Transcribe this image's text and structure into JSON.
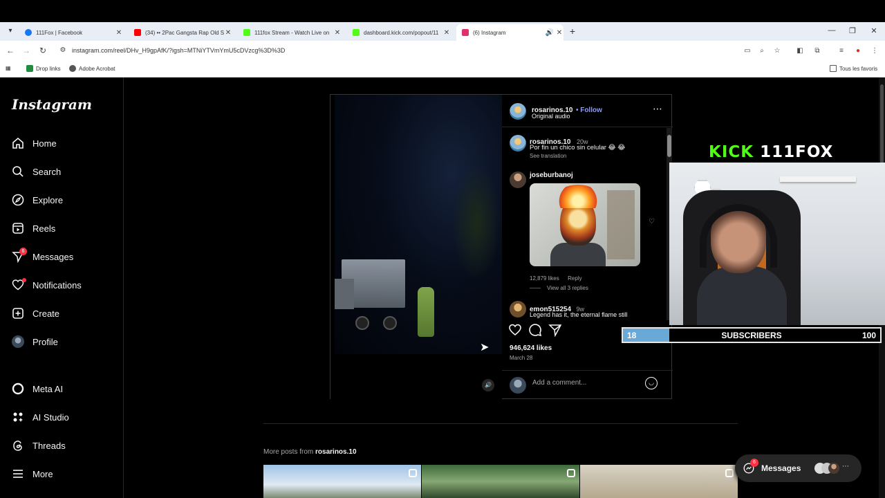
{
  "browser": {
    "tabs": [
      {
        "title": "111Fox | Facebook",
        "favicon_color": "#1877f2"
      },
      {
        "title": "(34) •• 2Pac Gangsta Rap Old S",
        "favicon_color": "#ff0000"
      },
      {
        "title": "111fox Stream - Watch Live on",
        "favicon_color": "#53fc18"
      },
      {
        "title": "dashboard.kick.com/popout/11",
        "favicon_color": "#53fc18"
      },
      {
        "title": "(6) Instagram",
        "favicon_color": "#e1306c"
      }
    ],
    "url": "instagram.com/reel/DHv_H9gpAfK/?igsh=MTNiYTVmYmU5cDVzcg%3D%3D",
    "bookmarks": [
      {
        "label": "Drop links",
        "color": "#1e8e3e"
      },
      {
        "label": "Adobe Acrobat",
        "color": "#555555"
      }
    ],
    "bookmarks_right": "Tous les favoris"
  },
  "instagram": {
    "logo": "Instagram",
    "nav": [
      {
        "label": "Home",
        "icon": "home-icon"
      },
      {
        "label": "Search",
        "icon": "search-icon"
      },
      {
        "label": "Explore",
        "icon": "compass-icon"
      },
      {
        "label": "Reels",
        "icon": "reels-icon"
      },
      {
        "label": "Messages",
        "icon": "messenger-icon",
        "badge": "6"
      },
      {
        "label": "Notifications",
        "icon": "heart-icon",
        "dot": true
      },
      {
        "label": "Create",
        "icon": "plus-square-icon"
      },
      {
        "label": "Profile",
        "icon": "avatar-icon"
      },
      {
        "label": "Meta AI",
        "icon": "meta-ai-icon"
      },
      {
        "label": "AI Studio",
        "icon": "ai-studio-icon"
      },
      {
        "label": "Threads",
        "icon": "threads-icon"
      },
      {
        "label": "More",
        "icon": "menu-icon"
      }
    ],
    "post": {
      "author": "rosarinos.10",
      "follow": "• Follow",
      "audio": "Original audio",
      "caption_user": "rosarinos.10",
      "caption_age": "20w",
      "caption": "Por fin un chico sin celular 😂 😂",
      "see_translation": "See translation",
      "comments": [
        {
          "user": "joseburbanoj",
          "likes": "12,879 likes",
          "reply": "Reply",
          "view_replies": "View all 3 replies"
        },
        {
          "user": "emon515254",
          "age": "9w",
          "text": "Legend has it, the eternal flame still"
        }
      ],
      "likes": "946,624 likes",
      "date": "March 28",
      "add_comment": "Add a comment..."
    },
    "more_posts_prefix": "More posts from",
    "more_posts_user": "rosarinos.10",
    "messages_pill": {
      "label": "Messages",
      "badge": "6"
    }
  },
  "stream_overlay": {
    "kick": "KICK",
    "channel": "111FOX",
    "subs_current": "18",
    "subs_label": "SUBSCRIBERS",
    "subs_goal": "100",
    "subs_progress": 0.18
  }
}
